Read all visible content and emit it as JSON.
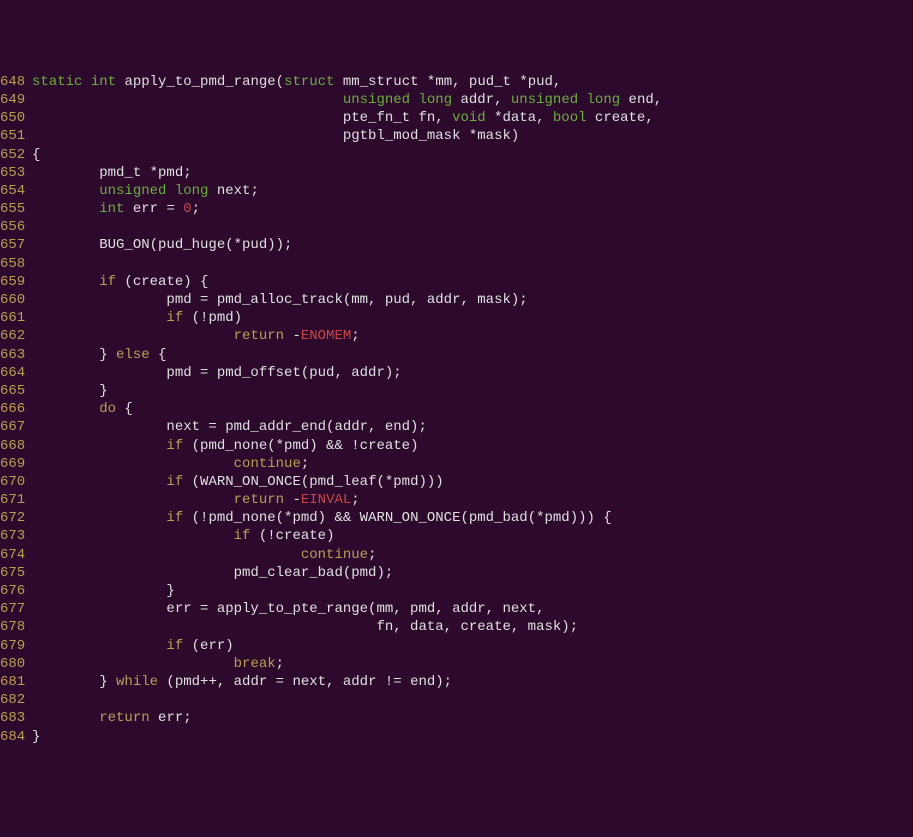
{
  "lines": [
    {
      "n": "648",
      "tokens": [
        {
          "t": "static",
          "c": "kw"
        },
        {
          "t": " ",
          "c": "ident"
        },
        {
          "t": "int",
          "c": "kw"
        },
        {
          "t": " apply_to_pmd_range(",
          "c": "ident"
        },
        {
          "t": "struct",
          "c": "kw"
        },
        {
          "t": " mm_struct *mm, pud_t *pud,",
          "c": "ident"
        }
      ]
    },
    {
      "n": "649",
      "tokens": [
        {
          "t": "                                     ",
          "c": "ident"
        },
        {
          "t": "unsigned",
          "c": "kw"
        },
        {
          "t": " ",
          "c": "ident"
        },
        {
          "t": "long",
          "c": "kw"
        },
        {
          "t": " addr, ",
          "c": "ident"
        },
        {
          "t": "unsigned",
          "c": "kw"
        },
        {
          "t": " ",
          "c": "ident"
        },
        {
          "t": "long",
          "c": "kw"
        },
        {
          "t": " end,",
          "c": "ident"
        }
      ]
    },
    {
      "n": "650",
      "tokens": [
        {
          "t": "                                     pte_fn_t fn, ",
          "c": "ident"
        },
        {
          "t": "void",
          "c": "kw"
        },
        {
          "t": " *data, ",
          "c": "ident"
        },
        {
          "t": "bool",
          "c": "kw"
        },
        {
          "t": " create,",
          "c": "ident"
        }
      ]
    },
    {
      "n": "651",
      "tokens": [
        {
          "t": "                                     pgtbl_mod_mask *mask)",
          "c": "ident"
        }
      ]
    },
    {
      "n": "652",
      "tokens": [
        {
          "t": "{",
          "c": "ident"
        }
      ]
    },
    {
      "n": "653",
      "tokens": [
        {
          "t": "        pmd_t *pmd;",
          "c": "ident"
        }
      ]
    },
    {
      "n": "654",
      "tokens": [
        {
          "t": "        ",
          "c": "ident"
        },
        {
          "t": "unsigned",
          "c": "kw"
        },
        {
          "t": " ",
          "c": "ident"
        },
        {
          "t": "long",
          "c": "kw"
        },
        {
          "t": " next;",
          "c": "ident"
        }
      ]
    },
    {
      "n": "655",
      "tokens": [
        {
          "t": "        ",
          "c": "ident"
        },
        {
          "t": "int",
          "c": "kw"
        },
        {
          "t": " err = ",
          "c": "ident"
        },
        {
          "t": "0",
          "c": "num"
        },
        {
          "t": ";",
          "c": "ident"
        }
      ]
    },
    {
      "n": "656",
      "tokens": [
        {
          "t": "",
          "c": "ident"
        }
      ]
    },
    {
      "n": "657",
      "tokens": [
        {
          "t": "        BUG_ON(pud_huge(*pud));",
          "c": "ident"
        }
      ]
    },
    {
      "n": "658",
      "tokens": [
        {
          "t": "",
          "c": "ident"
        }
      ]
    },
    {
      "n": "659",
      "tokens": [
        {
          "t": "        ",
          "c": "ident"
        },
        {
          "t": "if",
          "c": "ctrl"
        },
        {
          "t": " (create) {",
          "c": "ident"
        }
      ]
    },
    {
      "n": "660",
      "tokens": [
        {
          "t": "                pmd = pmd_alloc_track(mm, pud, addr, mask);",
          "c": "ident"
        }
      ]
    },
    {
      "n": "661",
      "tokens": [
        {
          "t": "                ",
          "c": "ident"
        },
        {
          "t": "if",
          "c": "ctrl"
        },
        {
          "t": " (!pmd)",
          "c": "ident"
        }
      ]
    },
    {
      "n": "662",
      "tokens": [
        {
          "t": "                        ",
          "c": "ident"
        },
        {
          "t": "return",
          "c": "ctrl"
        },
        {
          "t": " -",
          "c": "ident"
        },
        {
          "t": "ENOMEM",
          "c": "const"
        },
        {
          "t": ";",
          "c": "ident"
        }
      ]
    },
    {
      "n": "663",
      "tokens": [
        {
          "t": "        } ",
          "c": "ident"
        },
        {
          "t": "else",
          "c": "ctrl"
        },
        {
          "t": " {",
          "c": "ident"
        }
      ]
    },
    {
      "n": "664",
      "tokens": [
        {
          "t": "                pmd = pmd_offset(pud, addr);",
          "c": "ident"
        }
      ]
    },
    {
      "n": "665",
      "tokens": [
        {
          "t": "        }",
          "c": "ident"
        }
      ]
    },
    {
      "n": "666",
      "tokens": [
        {
          "t": "        ",
          "c": "ident"
        },
        {
          "t": "do",
          "c": "ctrl"
        },
        {
          "t": " {",
          "c": "ident"
        }
      ]
    },
    {
      "n": "667",
      "tokens": [
        {
          "t": "                next = pmd_addr_end(addr, end);",
          "c": "ident"
        }
      ]
    },
    {
      "n": "668",
      "tokens": [
        {
          "t": "                ",
          "c": "ident"
        },
        {
          "t": "if",
          "c": "ctrl"
        },
        {
          "t": " (pmd_none(*pmd) && !create)",
          "c": "ident"
        }
      ]
    },
    {
      "n": "669",
      "tokens": [
        {
          "t": "                        ",
          "c": "ident"
        },
        {
          "t": "continue",
          "c": "ctrl"
        },
        {
          "t": ";",
          "c": "ident"
        }
      ]
    },
    {
      "n": "670",
      "tokens": [
        {
          "t": "                ",
          "c": "ident"
        },
        {
          "t": "if",
          "c": "ctrl"
        },
        {
          "t": " (WARN_ON_ONCE(pmd_leaf(*pmd)))",
          "c": "ident"
        }
      ]
    },
    {
      "n": "671",
      "tokens": [
        {
          "t": "                        ",
          "c": "ident"
        },
        {
          "t": "return",
          "c": "ctrl"
        },
        {
          "t": " -",
          "c": "ident"
        },
        {
          "t": "EINVAL",
          "c": "const"
        },
        {
          "t": ";",
          "c": "ident"
        }
      ]
    },
    {
      "n": "672",
      "tokens": [
        {
          "t": "                ",
          "c": "ident"
        },
        {
          "t": "if",
          "c": "ctrl"
        },
        {
          "t": " (!pmd_none(*pmd) && WARN_ON_ONCE(pmd_bad(*pmd))) {",
          "c": "ident"
        }
      ]
    },
    {
      "n": "673",
      "tokens": [
        {
          "t": "                        ",
          "c": "ident"
        },
        {
          "t": "if",
          "c": "ctrl"
        },
        {
          "t": " (!create)",
          "c": "ident"
        }
      ]
    },
    {
      "n": "674",
      "tokens": [
        {
          "t": "                                ",
          "c": "ident"
        },
        {
          "t": "continue",
          "c": "ctrl"
        },
        {
          "t": ";",
          "c": "ident"
        }
      ]
    },
    {
      "n": "675",
      "tokens": [
        {
          "t": "                        pmd_clear_bad(pmd);",
          "c": "ident"
        }
      ]
    },
    {
      "n": "676",
      "tokens": [
        {
          "t": "                }",
          "c": "ident"
        }
      ]
    },
    {
      "n": "677",
      "tokens": [
        {
          "t": "                err = apply_to_pte_range(mm, pmd, addr, next,",
          "c": "ident"
        }
      ]
    },
    {
      "n": "678",
      "tokens": [
        {
          "t": "                                         fn, data, create, mask);",
          "c": "ident"
        }
      ]
    },
    {
      "n": "679",
      "tokens": [
        {
          "t": "                ",
          "c": "ident"
        },
        {
          "t": "if",
          "c": "ctrl"
        },
        {
          "t": " (err)",
          "c": "ident"
        }
      ]
    },
    {
      "n": "680",
      "tokens": [
        {
          "t": "                        ",
          "c": "ident"
        },
        {
          "t": "break",
          "c": "ctrl"
        },
        {
          "t": ";",
          "c": "ident"
        }
      ]
    },
    {
      "n": "681",
      "tokens": [
        {
          "t": "        } ",
          "c": "ident"
        },
        {
          "t": "while",
          "c": "ctrl"
        },
        {
          "t": " (pmd++, addr = next, addr != end);",
          "c": "ident"
        }
      ]
    },
    {
      "n": "682",
      "tokens": [
        {
          "t": "",
          "c": "ident"
        }
      ]
    },
    {
      "n": "683",
      "tokens": [
        {
          "t": "        ",
          "c": "ident"
        },
        {
          "t": "return",
          "c": "ctrl"
        },
        {
          "t": " err;",
          "c": "ident"
        }
      ]
    },
    {
      "n": "684",
      "tokens": [
        {
          "t": "}",
          "c": "ident"
        }
      ]
    }
  ]
}
